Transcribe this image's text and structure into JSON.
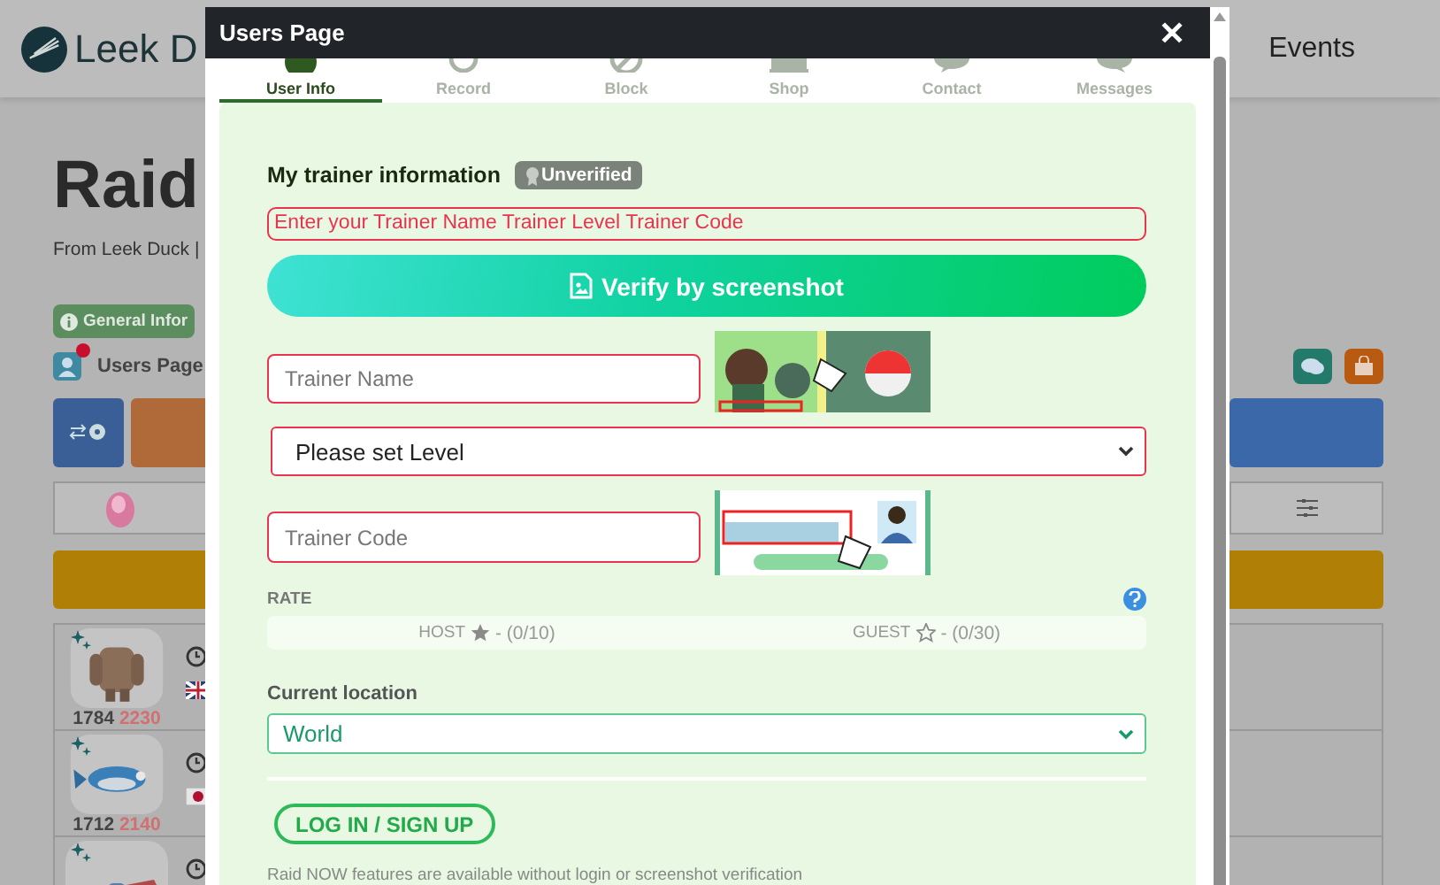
{
  "background": {
    "logo_text": "Leek D",
    "nav_item": "Events",
    "title": "Raid",
    "subtitle": "From Leek Duck |",
    "info_badge": "General Infor",
    "users_link": "Users Page",
    "users_alert": true,
    "raids": [
      {
        "kind": "entry",
        "cp": "1784",
        "cp_boosted": "2230"
      },
      {
        "kind": "entry",
        "cp": "1712",
        "cp_boosted": "2140"
      },
      {
        "kind": "partial"
      }
    ]
  },
  "modal": {
    "title": "Users Page",
    "close": "✕",
    "tabs": [
      {
        "label": "User Info",
        "selected": true
      },
      {
        "label": "Record",
        "selected": false
      },
      {
        "label": "Block",
        "selected": false
      },
      {
        "label": "Shop",
        "selected": false
      },
      {
        "label": "Contact",
        "selected": false
      },
      {
        "label": "Messages",
        "selected": false
      }
    ],
    "section_title": "My trainer information",
    "status_badge": "Unverified",
    "alert": "Enter your Trainer Name Trainer Level Trainer Code",
    "verify_button": "Verify by screenshot",
    "trainer_name": {
      "placeholder": "Trainer Name",
      "invalid": true
    },
    "level_select": {
      "value": "Please set Level",
      "invalid": true
    },
    "trainer_code": {
      "placeholder": "Trainer Code",
      "invalid": true
    },
    "rate": {
      "label": "RATE",
      "host_label": "HOST",
      "host_value": "- (0/10)",
      "guest_label": "GUEST",
      "guest_value": "- (0/30)"
    },
    "location": {
      "label": "Current location",
      "value": "World",
      "invalid": false
    },
    "login_button": "LOG IN / SIGN UP",
    "footer_note": "Raid NOW features are available without login or screenshot verification"
  }
}
